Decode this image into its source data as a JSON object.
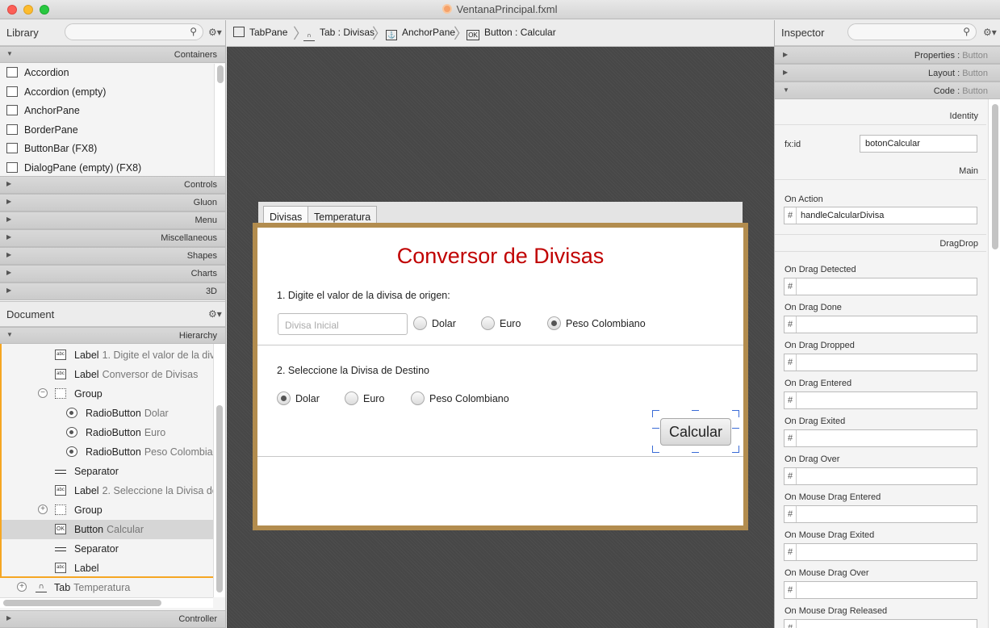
{
  "window": {
    "title": "VentanaPrincipal.fxml"
  },
  "library": {
    "title": "Library",
    "search_placeholder": "",
    "containers_label": "Containers",
    "items": [
      "Accordion",
      "Accordion  (empty)",
      "AnchorPane",
      "BorderPane",
      "ButtonBar  (FX8)",
      "DialogPane (empty)  (FX8)"
    ],
    "sections": [
      "Controls",
      "Gluon",
      "Menu",
      "Miscellaneous",
      "Shapes",
      "Charts",
      "3D"
    ]
  },
  "document": {
    "title": "Document",
    "hierarchy_label": "Hierarchy",
    "controller_label": "Controller",
    "rows": [
      {
        "type": "Label",
        "value": "1. Digite el valor de la divi"
      },
      {
        "type": "Label",
        "value": "Conversor de Divisas"
      },
      {
        "type": "Group",
        "value": ""
      },
      {
        "type": "RadioButton",
        "value": "Dolar"
      },
      {
        "type": "RadioButton",
        "value": "Euro"
      },
      {
        "type": "RadioButton",
        "value": "Peso Colombia"
      },
      {
        "type": "Separator",
        "value": ""
      },
      {
        "type": "Label",
        "value": "2. Seleccione la Divisa de"
      },
      {
        "type": "Group",
        "value": ""
      },
      {
        "type": "Button",
        "value": "Calcular"
      },
      {
        "type": "Separator",
        "value": ""
      },
      {
        "type": "Label",
        "value": ""
      },
      {
        "type": "Tab",
        "value": "Temperatura"
      }
    ]
  },
  "breadcrumb": [
    "TabPane",
    "Tab : Divisas",
    "AnchorPane",
    "Button : Calcular"
  ],
  "form": {
    "tabs": [
      "Divisas",
      "Temperatura"
    ],
    "heading": "Conversor de Divisas",
    "step1_label": "1. Digite el valor de la divisa de origen:",
    "input_placeholder": "Divisa Inicial",
    "origin_options": [
      "Dolar",
      "Euro",
      "Peso Colombiano"
    ],
    "origin_selected": "Peso Colombiano",
    "step2_label": "2. Seleccione la Divisa de Destino",
    "dest_options": [
      "Dolar",
      "Euro",
      "Peso Colombiano"
    ],
    "dest_selected": "Dolar",
    "calc_button": "Calcular"
  },
  "inspector": {
    "title": "Inspector",
    "sections": [
      {
        "name": "Properties",
        "target": "Button"
      },
      {
        "name": "Layout",
        "target": "Button"
      },
      {
        "name": "Code",
        "target": "Button"
      }
    ],
    "identity_label": "Identity",
    "fxid_label": "fx:id",
    "fxid_value": "botonCalcular",
    "main_label": "Main",
    "on_action_label": "On Action",
    "on_action_value": "handleCalcularDivisa",
    "dragdrop_label": "DragDrop",
    "events": [
      "On Drag Detected",
      "On Drag Done",
      "On Drag Dropped",
      "On Drag Entered",
      "On Drag Exited",
      "On Drag Over",
      "On Mouse Drag Entered",
      "On Mouse Drag Exited",
      "On Mouse Drag Over",
      "On Mouse Drag Released"
    ],
    "hash": "#"
  },
  "colors": {
    "heading": "#c00000",
    "selection_border": "#b28c4e",
    "hierarchy_highlight": "#f5a623",
    "handle": "#3a6bd6"
  }
}
